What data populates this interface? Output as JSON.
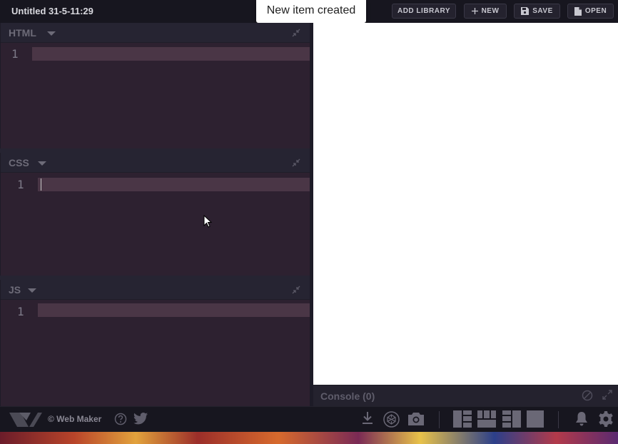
{
  "app": {
    "title": "Untitled 31-5-11:29"
  },
  "toast": {
    "message": "New item created"
  },
  "toolbar": {
    "add_library": "ADD LIBRARY",
    "new": "NEW",
    "save": "SAVE",
    "open": "OPEN"
  },
  "panes": {
    "html": {
      "title": "HTML",
      "line": "1"
    },
    "css": {
      "title": "CSS",
      "line": "1"
    },
    "js": {
      "title": "JS",
      "line": "1"
    }
  },
  "console": {
    "title": "Console (0)"
  },
  "footer": {
    "copyright": "© Web Maker"
  },
  "colors": {
    "background": "#1d1b27",
    "editor_bg": "#2d2130",
    "active_line": "#4a3646",
    "preview_bg": "#ffffff"
  },
  "icons": [
    "plus-icon",
    "floppy-disk-icon",
    "document-icon",
    "collapse-icon",
    "caret-down-icon",
    "block-icon",
    "expand-icon",
    "web-maker-logo",
    "help-icon",
    "twitter-icon",
    "download-icon",
    "codepen-icon",
    "camera-icon",
    "layout-1-icon",
    "layout-2-icon",
    "layout-3-icon",
    "layout-4-icon",
    "bell-icon",
    "gear-icon"
  ]
}
